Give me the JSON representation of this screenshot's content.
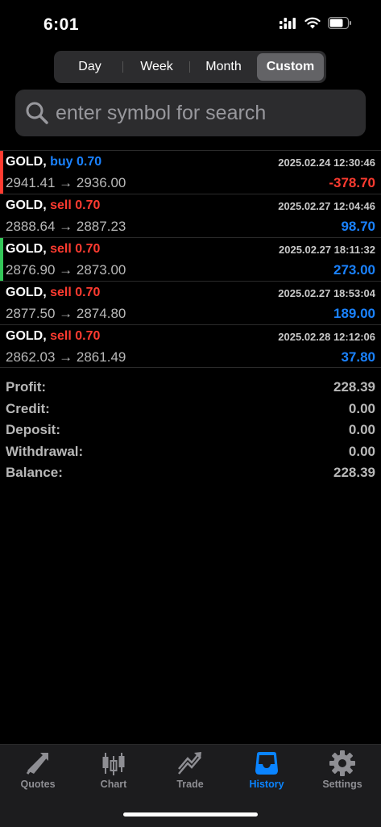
{
  "status_bar": {
    "time": "6:01"
  },
  "period_tabs": [
    {
      "label": "Day",
      "active": false
    },
    {
      "label": "Week",
      "active": false
    },
    {
      "label": "Month",
      "active": false
    },
    {
      "label": "Custom",
      "active": true
    }
  ],
  "search": {
    "placeholder": "enter symbol for search"
  },
  "deals": [
    {
      "symbol": "GOLD,",
      "side": "buy 0.70",
      "side_color": "blue",
      "prices": "2941.41 → 2936.00",
      "time": "2025.02.24 12:30:46",
      "profit": "-378.70",
      "profit_color": "red",
      "marker": "#ff3b30"
    },
    {
      "symbol": "GOLD,",
      "side": "sell 0.70",
      "side_color": "red",
      "prices": "2888.64 → 2887.23",
      "time": "2025.02.27 12:04:46",
      "profit": "98.70",
      "profit_color": "blue",
      "marker": ""
    },
    {
      "symbol": "GOLD,",
      "side": "sell 0.70",
      "side_color": "red",
      "prices": "2876.90 → 2873.00",
      "time": "2025.02.27 18:11:32",
      "profit": "273.00",
      "profit_color": "blue",
      "marker": "#34c759"
    },
    {
      "symbol": "GOLD,",
      "side": "sell 0.70",
      "side_color": "red",
      "prices": "2877.50 → 2874.80",
      "time": "2025.02.27 18:53:04",
      "profit": "189.00",
      "profit_color": "blue",
      "marker": ""
    },
    {
      "symbol": "GOLD,",
      "side": "sell 0.70",
      "side_color": "red",
      "prices": "2862.03 → 2861.49",
      "time": "2025.02.28 12:12:06",
      "profit": "37.80",
      "profit_color": "blue",
      "marker": ""
    }
  ],
  "summary": [
    {
      "label": "Profit:",
      "value": "228.39"
    },
    {
      "label": "Credit:",
      "value": "0.00"
    },
    {
      "label": "Deposit:",
      "value": "0.00"
    },
    {
      "label": "Withdrawal:",
      "value": "0.00"
    },
    {
      "label": "Balance:",
      "value": "228.39"
    }
  ],
  "tab_bar": [
    {
      "label": "Quotes",
      "icon": "quotes-icon",
      "active": false
    },
    {
      "label": "Chart",
      "icon": "candlestick-chart-icon",
      "active": false
    },
    {
      "label": "Trade",
      "icon": "trade-icon",
      "active": false
    },
    {
      "label": "History",
      "icon": "inbox-tray-icon",
      "active": true
    },
    {
      "label": "Settings",
      "icon": "gear-icon",
      "active": false
    }
  ],
  "colors": {
    "accent": "#0a84ff",
    "negative": "#ff3b30",
    "positive_marker": "#34c759"
  }
}
